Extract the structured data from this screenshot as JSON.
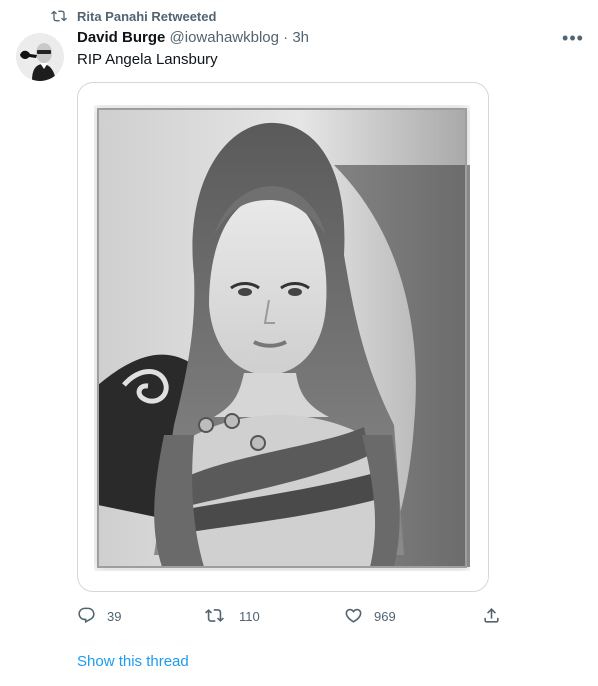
{
  "retweet": {
    "icon": "retweet-icon",
    "text": "Rita Panahi Retweeted"
  },
  "author": {
    "display_name": "David Burge",
    "handle": "@iowahawkblog",
    "separator": "·",
    "time": "3h"
  },
  "more_menu": {
    "icon": "more-icon",
    "label": "•••"
  },
  "tweet": {
    "text": "RIP Angela Lansbury"
  },
  "media": {
    "type": "black-and-white portrait photo"
  },
  "actions": {
    "reply": {
      "icon": "reply-icon",
      "count": "39"
    },
    "retweet": {
      "icon": "retweet-icon",
      "count": "110"
    },
    "like": {
      "icon": "heart-icon",
      "count": "969"
    },
    "share": {
      "icon": "share-icon"
    }
  },
  "thread": {
    "label": "Show this thread"
  },
  "colors": {
    "text_primary": "#0f1419",
    "text_secondary": "#536471",
    "link": "#1d9bf0",
    "border": "#cfd9de"
  }
}
